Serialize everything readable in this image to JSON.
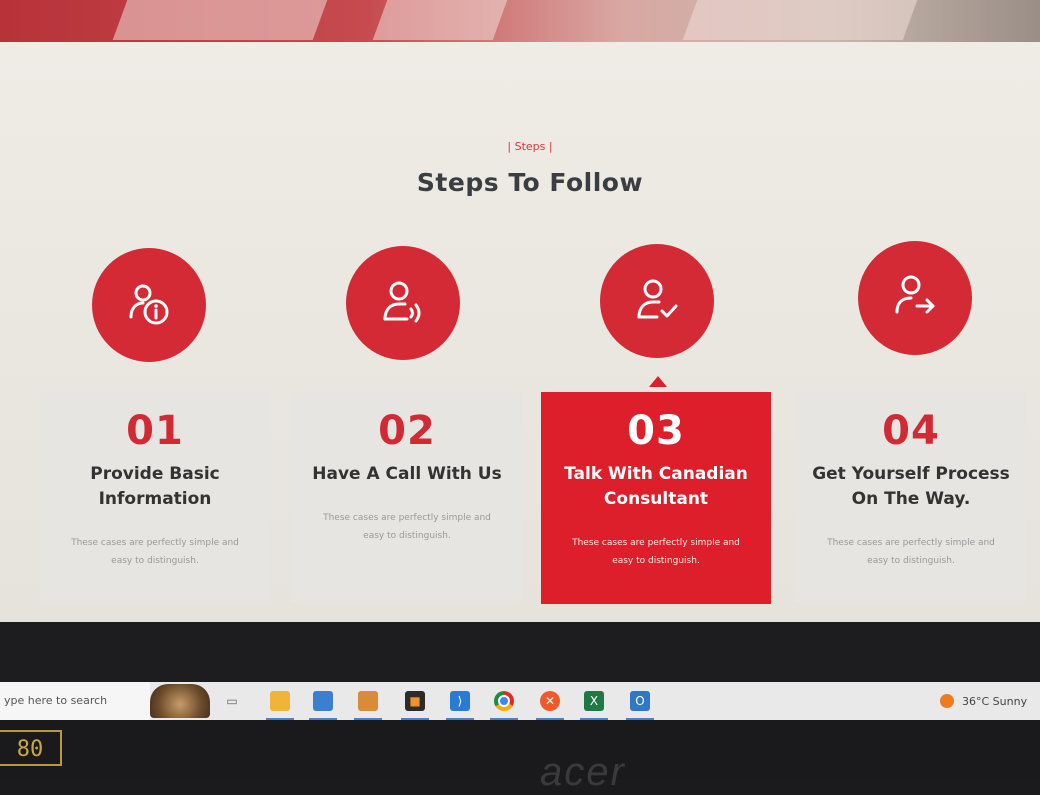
{
  "section": {
    "eyebrow": "| Steps |",
    "title": "Steps To Follow"
  },
  "steps": [
    {
      "number": "01",
      "title": "Provide Basic Information",
      "desc": "These cases are perfectly simple and easy to distinguish.",
      "icon": "user-info-icon",
      "active": false
    },
    {
      "number": "02",
      "title": "Have A Call With Us",
      "desc": "These cases are perfectly simple and easy to distinguish.",
      "icon": "user-call-icon",
      "active": false
    },
    {
      "number": "03",
      "title": "Talk With Canadian Consultant",
      "desc": "These cases are perfectly simple and easy to distinguish.",
      "icon": "user-check-icon",
      "active": true
    },
    {
      "number": "04",
      "title": "Get Yourself Process On The Way.",
      "desc": "These cases are perfectly simple and easy to distinguish.",
      "icon": "user-arrow-icon",
      "active": false
    }
  ],
  "taskbar": {
    "search_placeholder": "ype here to search",
    "weather": "36°C  Sunny",
    "apps": [
      "file-explorer-icon",
      "store-icon",
      "photos-icon",
      "sublime-icon",
      "vscode-icon",
      "chrome-icon",
      "brave-icon",
      "excel-icon",
      "outlook-icon"
    ]
  },
  "bezel": {
    "sticker": "80",
    "brand": "acer"
  },
  "colors": {
    "accent": "#d42a35",
    "active_card": "#dc1f2b",
    "title": "#3a3d42"
  }
}
